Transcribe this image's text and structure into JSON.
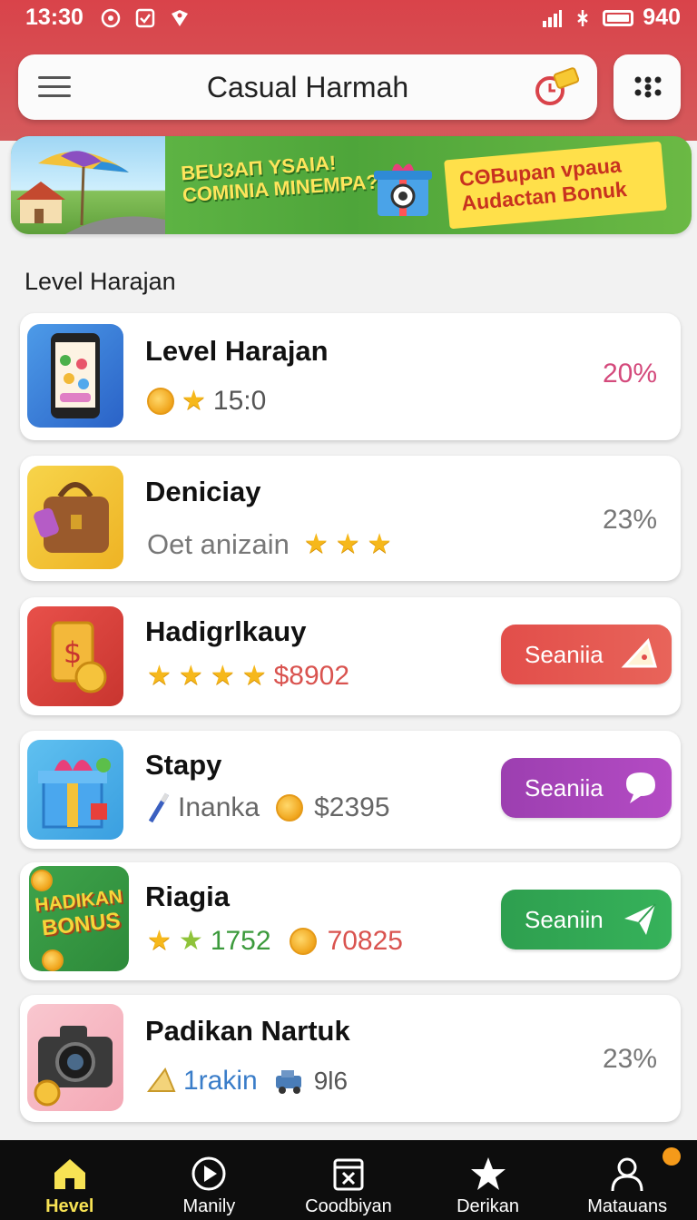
{
  "status_bar": {
    "time": "13:30",
    "battery": "940",
    "icons": [
      "circle-dot-icon",
      "check-square-icon",
      "heart-shield-icon"
    ],
    "right_icons": [
      "signal-icon",
      "wifi-icon",
      "battery-icon"
    ]
  },
  "header": {
    "title": "Casual Harmah",
    "menu_icon": "hamburger-icon",
    "timer_icon": "timer-ticket-icon",
    "grid_icon": "dots-grid-icon"
  },
  "banner": {
    "left_text": [
      "BEU3AΠ YSAIA!",
      "COMINIA MINEMPA?"
    ],
    "right_text": [
      "CΘBupan vpaua",
      "Audactan Bonuk"
    ]
  },
  "section_title": "Level Harajan",
  "cards": [
    {
      "name": "Level Harajan",
      "meta_value": "15:0",
      "percent": "20%",
      "percent_color": "#d44a7c",
      "meta_color": "#555555"
    },
    {
      "name": "Deniciay",
      "meta_text": "Oet anizain",
      "percent": "23%",
      "meta_color": "#777777"
    },
    {
      "name": "Hadigrlkauy",
      "meta_value": "$8902",
      "button": "Seaniia",
      "button_color": "#e24e4a",
      "meta_color": "#d9534f"
    },
    {
      "name": "Stapy",
      "meta_text": "Inanka",
      "meta_value": "$2395",
      "button": "Seaniia",
      "button_color": "#9c3fb0",
      "meta_color": "#666666"
    },
    {
      "name": "Riagia",
      "meta_text": "1752",
      "meta_value": "70825",
      "button": "Seaniin",
      "button_color": "#2e9f4f",
      "meta_color": "#d9534f",
      "meta_text_color": "#3c9a3c",
      "thumb_text": [
        "HADIKAN",
        "BONUS"
      ]
    },
    {
      "name": "Padikan Nartuk",
      "meta_text": "1rakin",
      "meta_value": "9l6",
      "percent": "23%",
      "meta_color": "#555555",
      "meta_text_color": "#3a7dc9"
    }
  ],
  "bottom_nav": [
    {
      "label": "Hevel",
      "icon": "home-icon",
      "active": true
    },
    {
      "label": "Manily",
      "icon": "play-circle-icon"
    },
    {
      "label": "Coodbiyan",
      "icon": "calendar-x-icon"
    },
    {
      "label": "Derikan",
      "icon": "star-icon"
    },
    {
      "label": "Matauans",
      "icon": "user-icon",
      "badge": true
    }
  ]
}
